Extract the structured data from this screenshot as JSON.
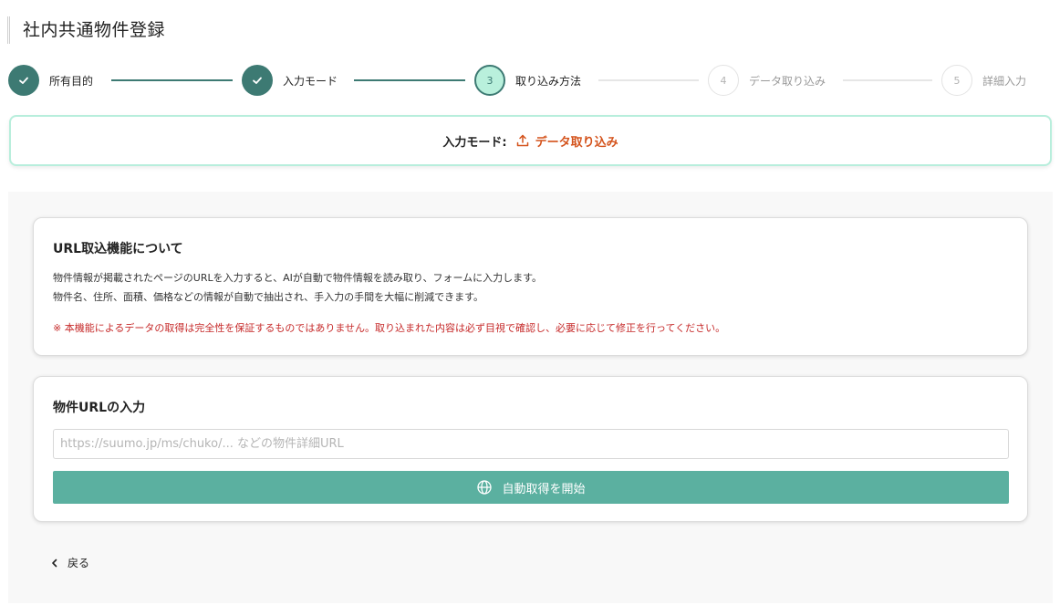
{
  "page": {
    "title": "社内共通物件登録"
  },
  "stepper": {
    "steps": [
      {
        "number": "1",
        "label": "所有目的",
        "status": "done"
      },
      {
        "number": "2",
        "label": "入力モード",
        "status": "done"
      },
      {
        "number": "3",
        "label": "取り込み方法",
        "status": "current"
      },
      {
        "number": "4",
        "label": "データ取り込み",
        "status": "pending"
      },
      {
        "number": "5",
        "label": "詳細入力",
        "status": "pending"
      }
    ]
  },
  "mode": {
    "label": "入力モード:",
    "value": "データ取り込み",
    "icon": "upload-icon"
  },
  "info_card": {
    "heading": "URL取込機能について",
    "line1": "物件情報が掲載されたページのURLを入力すると、AIが自動で物件情報を読み取り、フォームに入力します。",
    "line2": "物件名、住所、面積、価格などの情報が自動で抽出され、手入力の手間を大幅に削減できます。",
    "warning": "※ 本機能によるデータの取得は完全性を保証するものではありません。取り込まれた内容は必ず目視で確認し、必要に応じて修正を行ってください。"
  },
  "url_card": {
    "heading": "物件URLの入力",
    "input_value": "",
    "input_placeholder": "https://suumo.jp/ms/chuko/... などの物件詳細URL",
    "button_label": "自動取得を開始",
    "button_icon": "globe-icon"
  },
  "back": {
    "label": "戻る",
    "icon": "chevron-left-icon"
  },
  "colors": {
    "primary": "#3d7a73",
    "button": "#5bb0a0",
    "accent": "#d4531c",
    "warning": "#c62a2a",
    "current_step_fill": "#b9f0dc"
  }
}
